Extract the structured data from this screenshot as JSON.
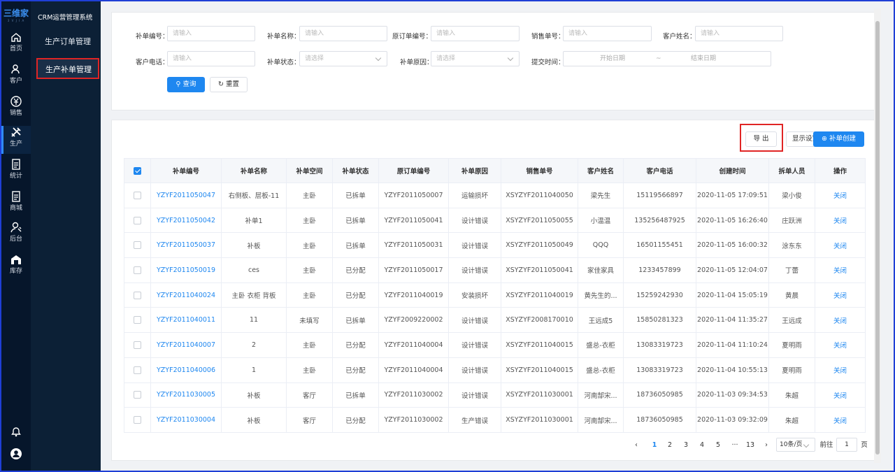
{
  "rail": {
    "logo": "三维家",
    "logo_sub": "3 V J I A",
    "items": [
      {
        "label": "首页",
        "icon": "home-icon"
      },
      {
        "label": "客户",
        "icon": "user-icon"
      },
      {
        "label": "销售",
        "icon": "yen-icon"
      },
      {
        "label": "生产",
        "icon": "tools-icon"
      },
      {
        "label": "统计",
        "icon": "doc-icon"
      },
      {
        "label": "商城",
        "icon": "doc-icon"
      },
      {
        "label": "后台",
        "icon": "gear-person-icon"
      },
      {
        "label": "库存",
        "icon": "warehouse-icon"
      }
    ]
  },
  "subnav": {
    "title": "CRM运营管理系统",
    "items": [
      "生产订单管理",
      "生产补单管理"
    ]
  },
  "search": {
    "fields": {
      "order_no": {
        "label": "补单编号：",
        "placeholder": "请输入"
      },
      "order_name": {
        "label": "补单名称：",
        "placeholder": "请输入"
      },
      "orig_no": {
        "label": "原订单编号：",
        "placeholder": "请输入"
      },
      "sales_no": {
        "label": "销售单号：",
        "placeholder": "请输入"
      },
      "cust_name": {
        "label": "客户姓名：",
        "placeholder": "请输入"
      },
      "cust_phone": {
        "label": "客户电话：",
        "placeholder": "请输入"
      },
      "status": {
        "label": "补单状态：",
        "placeholder": "请选择"
      },
      "reason": {
        "label": "补单原因：",
        "placeholder": "请选择"
      },
      "submit_time": {
        "label": "提交时间：",
        "start": "开始日期",
        "sep": "~",
        "end": "结束日期"
      }
    },
    "query_label": "查询",
    "reset_label": "重置"
  },
  "toolbar": {
    "export_label": "导 出",
    "display_label": "显示设置",
    "create_label": "补单创建"
  },
  "table": {
    "headers": [
      "补单编号",
      "补单名称",
      "补单空间",
      "补单状态",
      "原订单编号",
      "补单原因",
      "销售单号",
      "客户姓名",
      "客户电话",
      "创建时间",
      "拆单人员",
      "操作"
    ],
    "rows": [
      [
        "YZYF2011050047",
        "右侧板、层板-11",
        "主卧",
        "已拆单",
        "YZYF2011050007",
        "运输损坏",
        "XSYZYF2011040050",
        "梁先生",
        "15119566897",
        "2020-11-05 17:09:51",
        "梁小俊",
        "关闭"
      ],
      [
        "YZYF2011050042",
        "补单1",
        "主卧",
        "已拆单",
        "YZYF2011050041",
        "设计错误",
        "XSYZYF2011050055",
        "小温温",
        "135256487925",
        "2020-11-05 16:26:40",
        "庄跃洲",
        "关闭"
      ],
      [
        "YZYF2011050037",
        "补板",
        "主卧",
        "已拆单",
        "YZYF2011050031",
        "设计错误",
        "XSYZYF2011050049",
        "QQQ",
        "16501155451",
        "2020-11-05 16:00:32",
        "涂东东",
        "关闭"
      ],
      [
        "YZYF2011050019",
        "ces",
        "主卧",
        "已分配",
        "YZYF2011050017",
        "设计错误",
        "XSYZYF2011050041",
        "家佳家具",
        "1233457899",
        "2020-11-05 12:04:07",
        "丁蕾",
        "关闭"
      ],
      [
        "YZYF2011040024",
        "主卧 衣柜 背板",
        "主卧",
        "已分配",
        "YZYF2011040019",
        "安装损坏",
        "XSYZYF2011040019",
        "黄先生的...",
        "15259242930",
        "2020-11-04 15:05:19",
        "黄晨",
        "关闭"
      ],
      [
        "YZYF2011040011",
        "11",
        "未填写",
        "已拆单",
        "YZYF2009220002",
        "设计错误",
        "XSYZYF2008170010",
        "王远成5",
        "15850281323",
        "2020-11-04 11:35:27",
        "王远成",
        "关闭"
      ],
      [
        "YZYF2011040007",
        "2",
        "主卧",
        "已分配",
        "YZYF2011040004",
        "设计错误",
        "XSYZYF2011040015",
        "盛总-衣柜",
        "13083319723",
        "2020-11-04 11:10:24",
        "夏明雨",
        "关闭"
      ],
      [
        "YZYF2011040006",
        "1",
        "主卧",
        "已分配",
        "YZYF2011040004",
        "设计错误",
        "XSYZYF2011040015",
        "盛总-衣柜",
        "13083319723",
        "2020-11-04 10:55:13",
        "夏明雨",
        "关闭"
      ],
      [
        "YZYF2011030005",
        "补板",
        "客厅",
        "已拆单",
        "YZYF2011030002",
        "设计错误",
        "XSYZYF2011030001",
        "河南郜宋...",
        "18736050985",
        "2020-11-03 09:34:53",
        "朱超",
        "关闭"
      ],
      [
        "YZYF2011030004",
        "补板",
        "客厅",
        "已分配",
        "YZYF2011030002",
        "生产错误",
        "XSYZYF2011030001",
        "河南郜宋...",
        "18736050985",
        "2020-11-03 09:32:09",
        "朱超",
        "关闭"
      ]
    ]
  },
  "pager": {
    "pages": [
      "1",
      "2",
      "3",
      "4",
      "5",
      "···",
      "13"
    ],
    "current": "1",
    "page_size": "10条/页",
    "goto_label": "前往",
    "goto_value": "1",
    "page_unit": "页"
  },
  "colors": {
    "primary": "#1e87f0",
    "rail": "#06162b",
    "subnav": "#0c2036",
    "highlight": "#e02525"
  }
}
